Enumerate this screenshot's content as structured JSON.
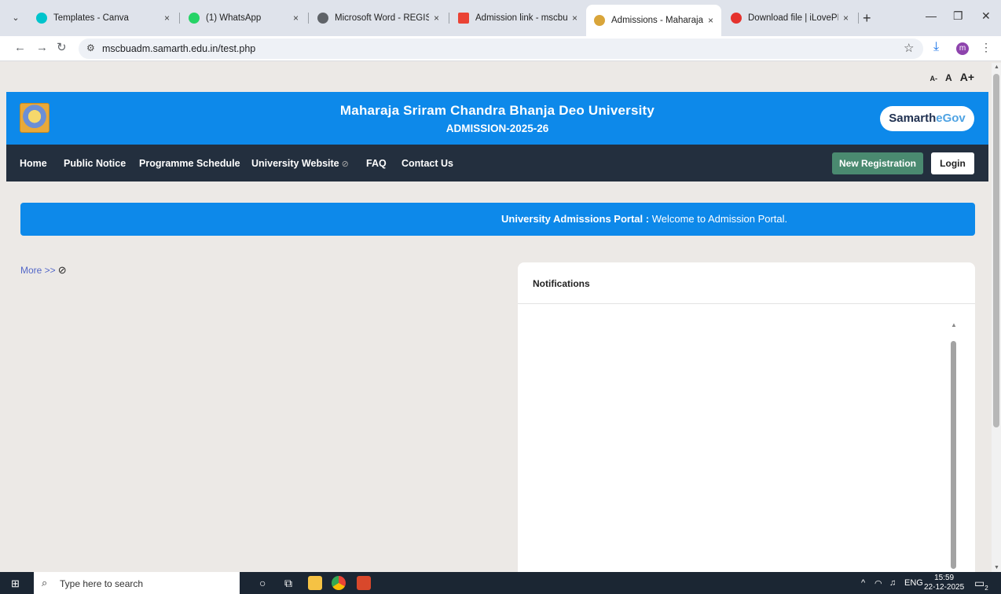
{
  "browser": {
    "tabs": [
      {
        "title": "Templates - Canva",
        "active": false
      },
      {
        "title": "(1) WhatsApp",
        "active": false
      },
      {
        "title": "Microsoft Word - REGISTRAT",
        "active": false
      },
      {
        "title": "Admission link - mscbusama",
        "active": false
      },
      {
        "title": "Admissions - Maharaja Sriran",
        "active": true
      },
      {
        "title": "Download file | iLovePDF",
        "active": false
      }
    ],
    "close_glyph": "×",
    "new_tab": "+",
    "url": "mscbuadm.samarth.edu.in/test.php",
    "profile_initial": "m",
    "window_controls": {
      "minimize": "—",
      "restore": "❐",
      "close": "✕"
    }
  },
  "page": {
    "font_controls": [
      "A-",
      "A",
      "A+"
    ],
    "header": {
      "university_name": "Maharaja Sriram Chandra Bhanja Deo University",
      "admission_year": "ADMISSION-2025-26",
      "samarth_brand": "Samarth",
      "samarth_egov": "eGov"
    },
    "nav": {
      "items": [
        "Home",
        "Public Notice",
        "Programme Schedule",
        "University Website",
        "FAQ",
        "Contact Us"
      ],
      "new_registration": "New Registration",
      "login": "Login"
    },
    "banner": {
      "label": "University Admissions Portal",
      "separator": " : ",
      "message": "Welcome to Admission Portal."
    },
    "more_link": "More >>",
    "notifications": {
      "title": "Notifications"
    }
  },
  "taskbar": {
    "search_placeholder": "Type here to search",
    "language": "ENG",
    "time": "15:59",
    "date": "22-12-2025",
    "notification_count": "2"
  },
  "colors": {
    "header_blue": "#0d89ea",
    "navbar_dark": "#232f3e",
    "registration_green": "#4a8a70",
    "page_bg": "#ece9e6"
  }
}
